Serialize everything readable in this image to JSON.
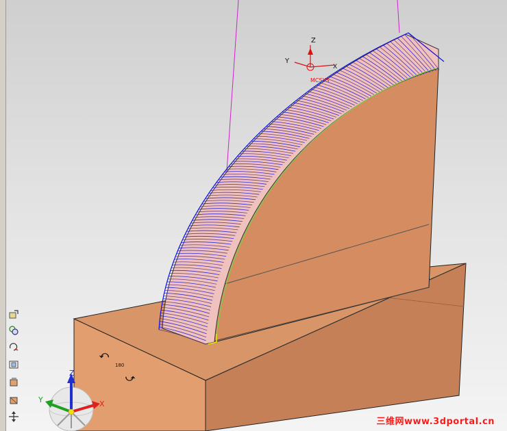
{
  "viewport": {
    "triad_top": {
      "z": "Z",
      "y": "Y",
      "x": "X",
      "origin_label": "MCSYS"
    },
    "triad_corner": {
      "z": "Z",
      "y": "Y",
      "x": "X"
    },
    "rotate_step_label": "180",
    "watermark": "三维网www.3dportal.cn",
    "colors": {
      "part_front": "#e09a6e",
      "part_side": "#c9845c",
      "part_top": "#d79669",
      "rib_side": "#d48c60",
      "toolpath": "#1010dd",
      "tool_axis": "#cc22cc",
      "highlight_edge": "#7ad04a"
    }
  },
  "toolbar": {
    "icons": [
      "view-fit-icon",
      "zoom-icon",
      "rotate-icon",
      "orient-icon",
      "shade-icon",
      "wireframe-icon",
      "pan-icon"
    ]
  }
}
